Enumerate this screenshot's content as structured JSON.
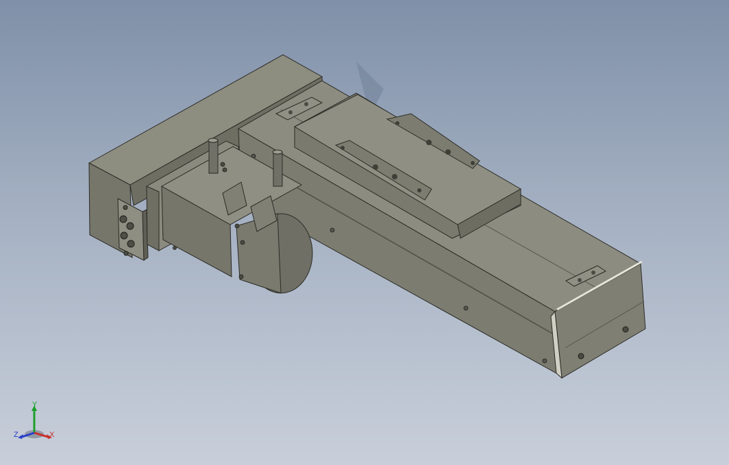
{
  "viewport": {
    "background_top": "#7f90a8",
    "background_bottom": "#c8cfda",
    "model_base_color": "#85857a"
  },
  "triad": {
    "x_label": "X",
    "y_label": "Y",
    "z_label": "Z",
    "x_color": "#c8302a",
    "y_color": "#1d9e2a",
    "z_color": "#2a3fc8"
  }
}
